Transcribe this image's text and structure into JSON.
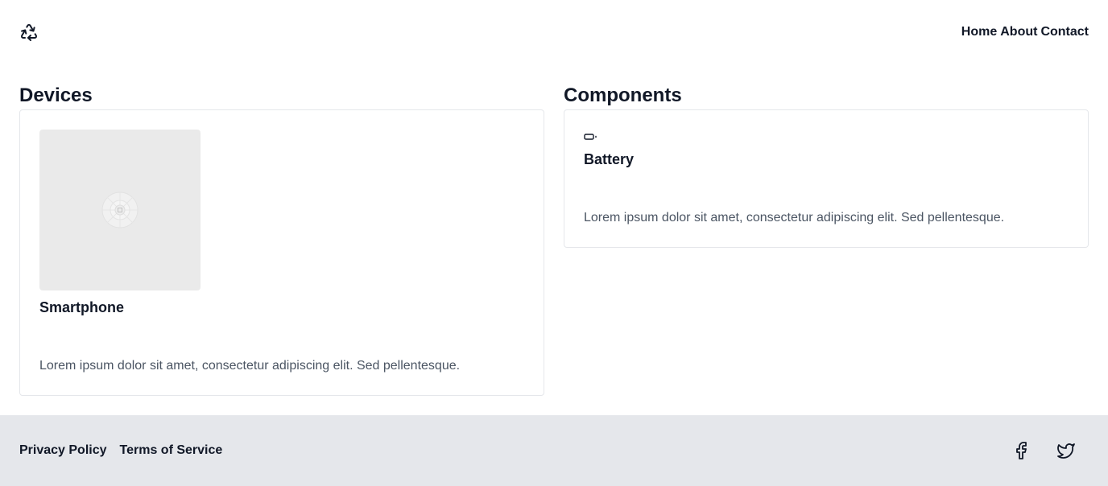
{
  "header": {
    "logo_icon": "recycle-icon",
    "nav": [
      {
        "label": "Home"
      },
      {
        "label": "About"
      },
      {
        "label": "Contact"
      }
    ]
  },
  "devices": {
    "title": "Devices",
    "items": [
      {
        "name": "Smartphone",
        "description": "Lorem ipsum dolor sit amet, consectetur adipiscing elit. Sed pellentesque.",
        "image_icon": "image-placeholder-icon"
      }
    ]
  },
  "components": {
    "title": "Components",
    "items": [
      {
        "name": "Battery",
        "description": "Lorem ipsum dolor sit amet, consectetur adipiscing elit. Sed pellentesque.",
        "icon": "battery-icon"
      }
    ]
  },
  "footer": {
    "links": [
      {
        "label": "Privacy Policy"
      },
      {
        "label": "Terms of Service"
      }
    ],
    "social_icons": [
      "facebook-icon",
      "twitter-icon"
    ]
  },
  "colors": {
    "text": "#111827",
    "muted_text": "#4b5563",
    "border": "#e5e7eb",
    "footer_bg": "#e5e7eb",
    "placeholder_bg": "#eaeaea"
  }
}
